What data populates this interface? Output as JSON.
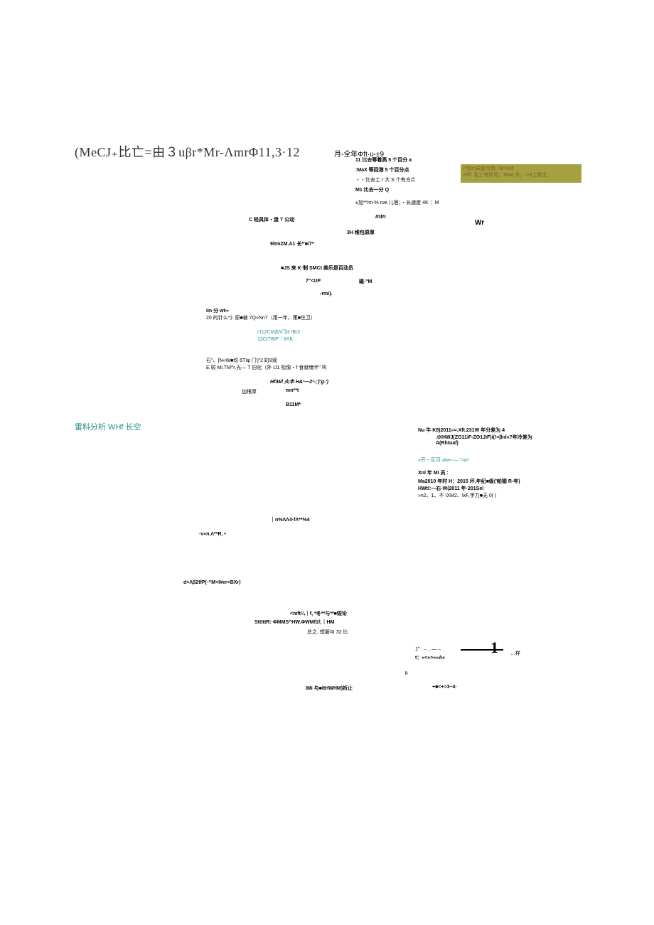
{
  "header": {
    "main": "(MeCJ₊比亡=由３uβr*Mr-ΛmrΦ11,3·12",
    "right": "月-全年Φft·υ-±9"
  },
  "topright": {
    "r1": "11 比去等着高 5 个百分 a",
    "r2": ":MaX 等回港 5 个百分点",
    "r3": "・・比去工 r 大 S 个有方片",
    "r4": "M1 比去一分 Q",
    "r5": "±加**/m-%.rue.儿宿；・长速度 4K｜ M"
  },
  "olive": {
    "l1": "i*资m末部今用 7&*AAf:",
    "l2": "Riff: 及工考件号；Rwd 方；・Hi上筑尤"
  },
  "mid": {
    "c1": "C 轻具体・盘 T 公动",
    "mtn": "mtn",
    "wr": "Wr",
    "h3": "3H 维包原厚",
    "nine": "9itmZM.A1 长*'■/7*",
    "js": "■JS 来 K·制 SMCt 美乐是百动员",
    "up": "7\"<UP",
    "upr": "磁-\"M",
    "rmi": "-rmi).",
    "iin": "iin          分 wt∞",
    "twenty": "20 的针么*》原■被 7Q»Nn7（用一年，策■住卫）",
    "r112": "r112CtΛβΛ门tt:*Br2",
    "r12": "12Ct7WP｜ttΛK·",
    "stone": "石\"、[N«W■均 6TIφ 门'j\"2 町8观",
    "emi": "E 较 Mi.TM^r.光— T 旧化（外 IJ1 松像・f 食就绪半\" 叫",
    "hfi": "HfiWl 火丰 H&¹—2²-;'j'g-')",
    "jia": "加根厚",
    "mn": "mn**t",
    "b11": "B11M*"
  },
  "section_title": "雷料分析 WHf 长空",
  "rightblock": {
    "nu": "Nu 牛 K9)2011«=.Xft.231W 年分差为 4",
    "tx": ".tXHWJ(ZO11iF-ZO1JiF)i(!≡βnl«?年冷差为",
    "ar": "A(Rhtuaf)",
    "sep": "»开・区可·aw«·— \"»aт",
    "xnl": "Xnl 年 MI 员 :",
    "ma": "Ma2010 年时 H：2015 坏.年纪■级('帕德 R-年)",
    "hw": "HWtl:—右-W(2011 年·201Sel",
    "n2": "»n2、1、不 IXM2、IxF,字力■无 0(                              )"
  },
  "lower": {
    "na": "｜n%ΛΛ4·fΛ**%4",
    "vn": "·v«n.Λ**R,                    •",
    "db": "d>Λβ2tfP(·^M<l#er<BXr)",
    "mft": "<mft¼｜f, *冬**与**■短论",
    "stt": "StttttR:·ΦMMS^HW.ΦWMf1f;｜HM",
    "zz": "总之, 想服与 32 比",
    "line1": "1\"  :→ ,  —→ .",
    "line2": "t：«<»>»«A«",
    "line3": "…样",
    "ell": "I-",
    "imi": "IMi 与■ltHWHM)祈止",
    "star": "+■<+>3~4·"
  }
}
